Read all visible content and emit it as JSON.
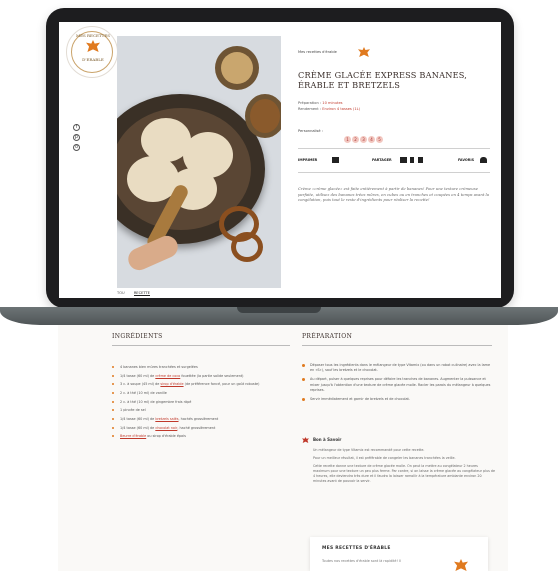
{
  "brand": {
    "logo_line_top": "MES RECETTES",
    "logo_line_bottom": "D'ERABLE",
    "accent": "#e07a1f",
    "link_color": "#c0392b"
  },
  "social_icons": [
    "facebook-icon",
    "pinterest-icon",
    "instagram-icon"
  ],
  "breadcrumb": "Mes recettes d'érable",
  "recipe": {
    "title": "CRÈME GLACÉE EXPRESS BANANES, ÉRABLE ET BRETZELS",
    "prep_label": "Préparation :",
    "prep_value": "10 minutes",
    "serves_label": "Rendement :",
    "serves_value": "Environ 4 tasses (1L)",
    "personalize_label": "Personnalisé :",
    "personalize_options": [
      "1",
      "2",
      "3",
      "4",
      "5"
    ],
    "intro": "Crème «crème glacée» est faite entièrement à partir de bananes! Pour une texture crémeuse parfaite, utilisez des bananes trèes mûres, en cubes ou en tranches et coupées en 4 temps avant la congélation, puis tout le reste d'ingrédients pour réaliser la recette!"
  },
  "share": {
    "print_label": "IMPRIMER",
    "share_label": "PARTAGER",
    "favorite_label": "FAVORIS"
  },
  "tabs": {
    "first": "TOU",
    "second": "RECETTE"
  },
  "ingredients": {
    "title": "INGRÉDIENTS",
    "items": [
      {
        "text": "4 bananes bien mûres tranchées et surgelées",
        "link": ""
      },
      {
        "text": "1/4 tasse (60 ml) de ",
        "link": "crème de coco",
        "rest": " fouettée (la partie solide seulement)"
      },
      {
        "text": "3 c. à soupe (45 ml) de ",
        "link": "sirop d'érable",
        "rest": " (de préférence foncé, pour un goût robuste)"
      },
      {
        "text": "2 c. à thé (10 ml) de vanille",
        "link": ""
      },
      {
        "text": "2 c. à thé (10 ml) de gingembre frais râpé",
        "link": ""
      },
      {
        "text": "1 pincée de sel",
        "link": ""
      },
      {
        "text": "1/4 tasse (60 ml) de ",
        "link": "bretzels salés",
        "rest": ", hachés grossièrement"
      },
      {
        "text": "1/4 tasse (60 ml) de ",
        "link": "chocolat noir",
        "rest": ", haché grossièrement"
      },
      {
        "text": "",
        "link": "Beurre d'érable",
        "rest": " ou sirop d'érable épais"
      }
    ]
  },
  "preparation": {
    "title": "PRÉPARATION",
    "steps": [
      "Déposer tous les ingrédients dans le mélangeur de type Vitamix (ou dans un robot culinaire) avec la lame en «S»), sauf les bretzels et le chocolat.",
      "Au départ, pulser à quelques reprises pour défaire les tranches de bananes. Augmenter la puissance et mixer jusqu'à l'obtention d'une texture de crème glacée molle. Racler les parois du mélangeur à quelques reprises.",
      "Servir immédiatement et garnir de bretzels et de chocolat."
    ],
    "tip_title": "Bon à Savoir",
    "tip_paragraphs": [
      "Un mélangeur de type Vitamix est recommandé pour cette recette.",
      "Pour un meilleur résultat, il est préférable de congeler les bananes tranchées la veille.",
      "Cette recette donne une texture de crème glacée molle. On peut la mettre au congélateur 2 heures maximum pour une texture un peu plus ferme. Par contre, si on laisse la crème glacée au congélateur plus de 4 heures, elle deviendra très dure et il faudra la laisser ramollir à la température ambiante environ 20 minutes avant de pouvoir la servir."
    ]
  },
  "promo_card": {
    "title": "MES RECETTES D'ÉRABLE",
    "text": "Toutes nos recettes d'érable sont là rapidité! Il"
  }
}
